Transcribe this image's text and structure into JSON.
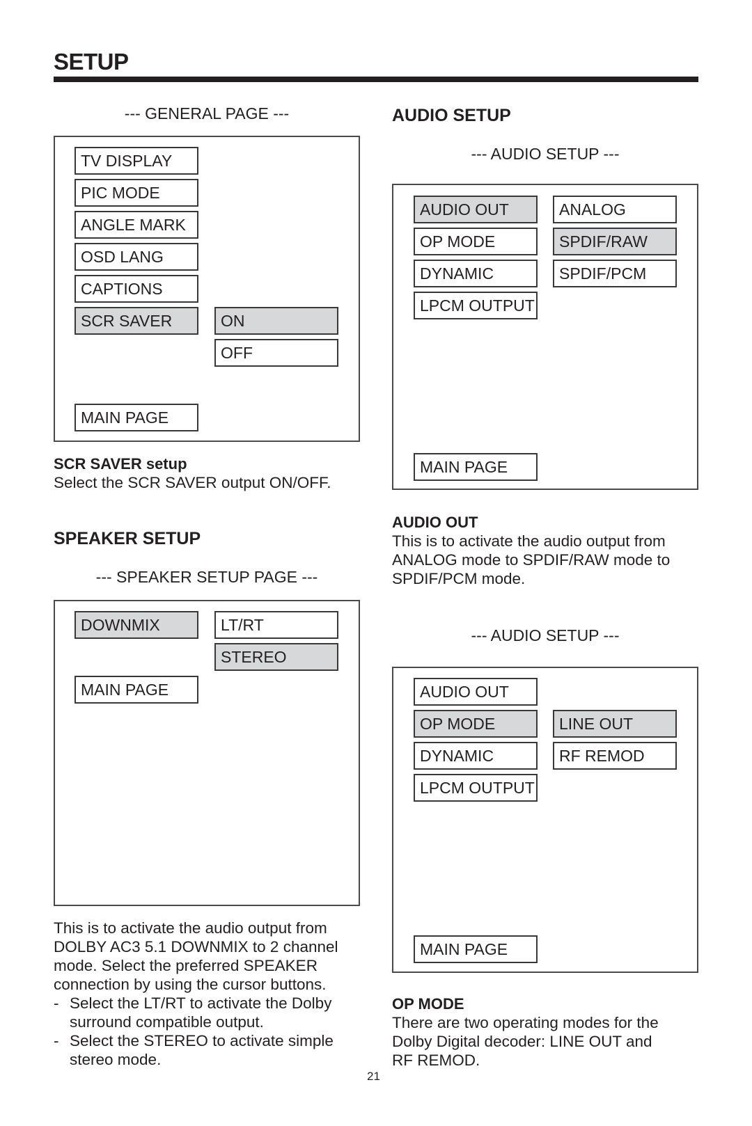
{
  "page": {
    "title": "SETUP",
    "page_number": "21"
  },
  "general": {
    "caption": "--- GENERAL PAGE ---",
    "menu": [
      "TV DISPLAY",
      "PIC MODE",
      "ANGLE MARK",
      "OSD LANG",
      "CAPTIONS",
      "SCR SAVER"
    ],
    "selected_menu": "SCR SAVER",
    "options": [
      "ON",
      "OFF"
    ],
    "selected_option": "ON",
    "main_page": "MAIN PAGE",
    "desc_title": "SCR SAVER setup",
    "desc_text": "Select the SCR SAVER output ON/OFF."
  },
  "speaker": {
    "heading": "SPEAKER SETUP",
    "caption": "--- SPEAKER SETUP PAGE ---",
    "menu": [
      "DOWNMIX"
    ],
    "selected_menu": "DOWNMIX",
    "options": [
      "LT/RT",
      "STEREO"
    ],
    "selected_option": "STEREO",
    "main_page": "MAIN PAGE",
    "desc_lines": [
      "This is to activate the audio output from",
      "DOLBY AC3 5.1 DOWNMIX to 2 channel",
      "mode.  Select the preferred SPEAKER",
      "connection by using the cursor buttons."
    ],
    "bullets": [
      {
        "dash": "-",
        "lines": [
          "Select the LT/RT to activate the Dolby",
          "surround compatible output."
        ]
      },
      {
        "dash": "-",
        "lines": [
          "Select the STEREO to activate simple",
          "stereo mode."
        ]
      }
    ]
  },
  "audio": {
    "heading": "AUDIO SETUP",
    "screen1": {
      "caption": "--- AUDIO SETUP ---",
      "menu": [
        "AUDIO OUT",
        "OP MODE",
        "DYNAMIC",
        "LPCM OUTPUT"
      ],
      "selected_menu": "AUDIO OUT",
      "options": [
        "ANALOG",
        "SPDIF/RAW",
        "SPDIF/PCM"
      ],
      "selected_option": "SPDIF/RAW",
      "main_page": "MAIN PAGE",
      "desc_title": "AUDIO OUT",
      "desc_lines": [
        "This is to activate the audio output from",
        "ANALOG mode to SPDIF/RAW mode to",
        "SPDIF/PCM mode."
      ]
    },
    "screen2": {
      "caption": "--- AUDIO SETUP ---",
      "menu": [
        "AUDIO OUT",
        "OP MODE",
        "DYNAMIC",
        "LPCM OUTPUT"
      ],
      "selected_menu": "OP MODE",
      "options": [
        "LINE OUT",
        "RF REMOD"
      ],
      "selected_option": "LINE OUT",
      "main_page": "MAIN PAGE",
      "desc_title": "OP MODE",
      "desc_lines": [
        "There are two operating modes for the",
        "Dolby Digital decoder:  LINE OUT and",
        "RF REMOD."
      ]
    }
  },
  "colors": {
    "text": "#231f20",
    "highlight": "#d7d8da",
    "border": "#3a3839"
  }
}
